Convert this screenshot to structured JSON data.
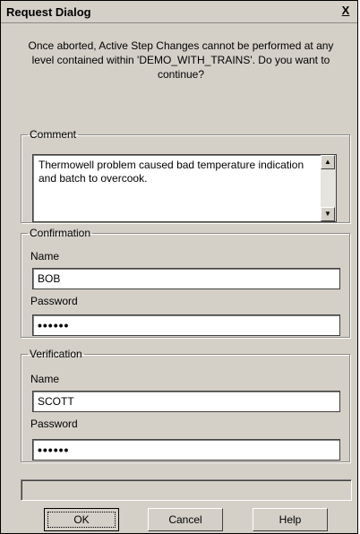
{
  "window": {
    "title": "Request Dialog",
    "close_label": "X"
  },
  "message": "Once aborted, Active Step Changes cannot be performed at any level contained within 'DEMO_WITH_TRAINS'.  Do you want to continue?",
  "comment": {
    "legend": "Comment",
    "value": "Thermowell problem caused bad temperature indication and batch to overcook."
  },
  "confirmation": {
    "legend": "Confirmation",
    "name_label": "Name",
    "name_value": "BOB",
    "password_label": "Password",
    "password_value": "••••••"
  },
  "verification": {
    "legend": "Verification",
    "name_label": "Name",
    "name_value": "SCOTT",
    "password_label": "Password",
    "password_value": "••••••"
  },
  "buttons": {
    "ok": "OK",
    "cancel": "Cancel",
    "help": "Help"
  }
}
